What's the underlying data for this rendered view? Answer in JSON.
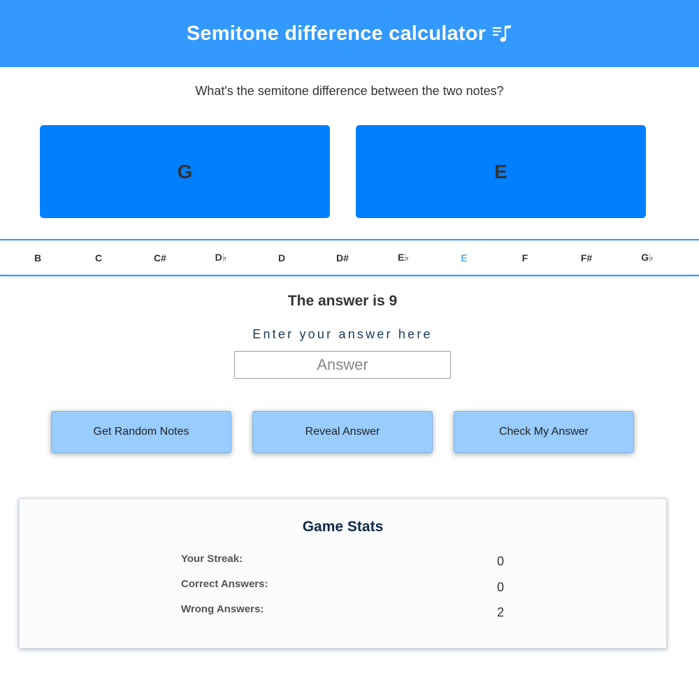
{
  "header": {
    "title": "Semitone difference calculator",
    "icon": "music-note-icon",
    "background": "#3399ff"
  },
  "question": "What's the semitone difference between the two notes?",
  "notes": {
    "first": "G",
    "second": "E",
    "card_color": "#0080ff"
  },
  "note_strip": {
    "items": [
      "B",
      "C",
      "C#",
      "D♭",
      "D",
      "D#",
      "E♭",
      "E",
      "F",
      "F#",
      "G♭"
    ],
    "active": "E"
  },
  "answer_text": "The answer is 9",
  "input": {
    "label": "Enter your answer here",
    "placeholder": "Answer",
    "value": ""
  },
  "buttons": {
    "random": "Get Random Notes",
    "reveal": "Reveal Answer",
    "check": "Check My Answer"
  },
  "stats": {
    "title": "Game Stats",
    "rows": [
      {
        "label": "Your Streak:",
        "value": "0"
      },
      {
        "label": "Correct Answers:",
        "value": "0"
      },
      {
        "label": "Wrong Answers:",
        "value": "2"
      }
    ]
  }
}
